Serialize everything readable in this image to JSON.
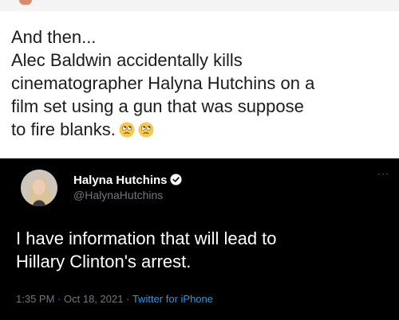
{
  "post": {
    "lines": [
      "And then...",
      "Alec Baldwin accidentally kills",
      "cinematographer Halyna Hutchins on a",
      "film set using a gun that was suppose",
      "to fire blanks."
    ],
    "emoji": [
      "rolling-eyes-emoji",
      "rolling-eyes-emoji"
    ]
  },
  "tweet": {
    "display_name": "Halyna Hutchins",
    "handle": "@HalynaHutchins",
    "more": "···",
    "text_lines": [
      "I have information that will lead to",
      "Hillary Clinton's arrest."
    ],
    "time": "1:35 PM",
    "date": "Oct 18, 2021",
    "source": "Twitter for iPhone",
    "separator": "·"
  },
  "colors": {
    "card_bg": "#000000",
    "muted": "#71767b",
    "link": "#1d9bf0",
    "verified": "#ffffff"
  }
}
